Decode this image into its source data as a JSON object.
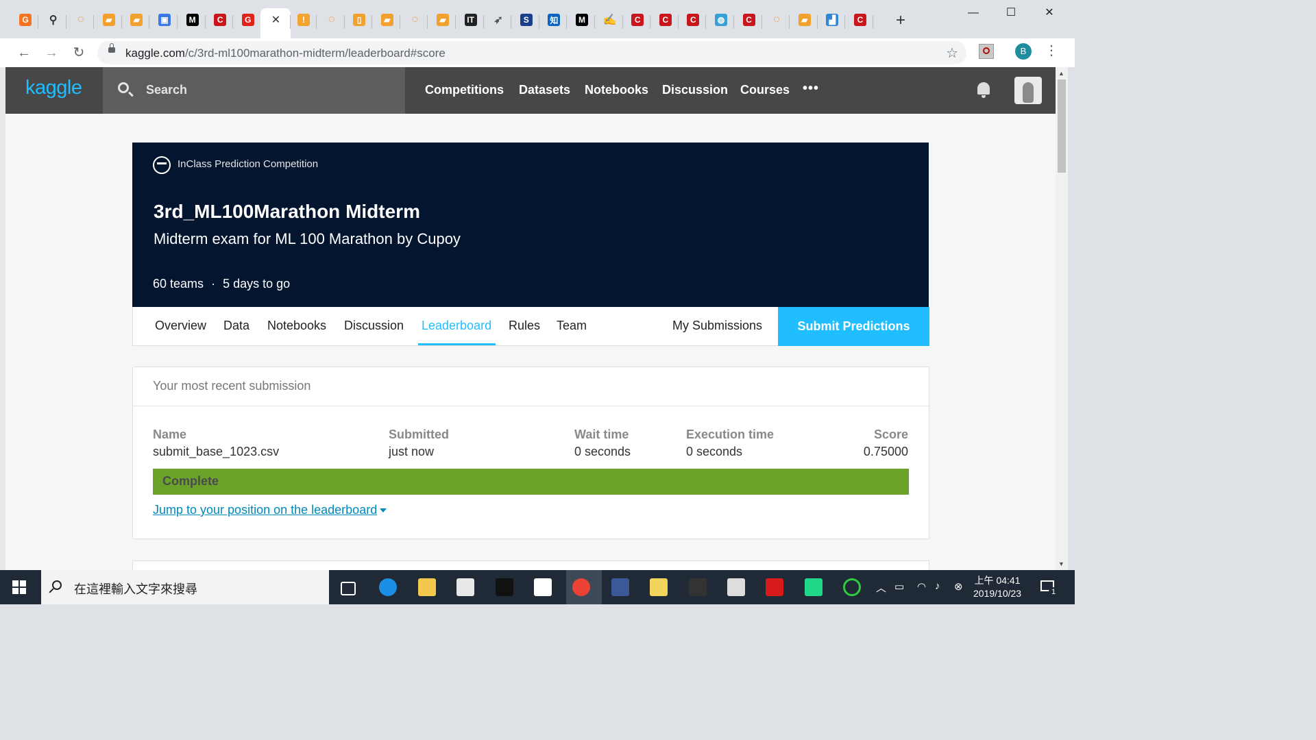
{
  "browser": {
    "tab_icons": [
      {
        "name": "firefox-like-icon",
        "color": "#f97420",
        "glyph": "G"
      },
      {
        "name": "network-icon",
        "color": "#333333",
        "glyph": "⚲"
      },
      {
        "name": "loading-icon",
        "color": "#f57c00",
        "glyph": "◌"
      },
      {
        "name": "book-icon",
        "color": "#f2a12f",
        "glyph": "▰"
      },
      {
        "name": "book-icon",
        "color": "#f2a12f",
        "glyph": "▰"
      },
      {
        "name": "contact-icon",
        "color": "#3b78e7",
        "glyph": "▣"
      },
      {
        "name": "medium-icon",
        "color": "#000000",
        "glyph": "M"
      },
      {
        "name": "csdn-icon",
        "color": "#c9161c",
        "glyph": "C"
      },
      {
        "name": "refresh-red-icon",
        "color": "#e2231a",
        "glyph": "G"
      },
      {
        "name": "close-tab-icon",
        "color": "#ffffff",
        "glyph": "✕"
      },
      {
        "name": "kaggle-tab-icon",
        "color": "#f1a431",
        "glyph": "!"
      },
      {
        "name": "loading-icon",
        "color": "#f57c00",
        "glyph": "◌"
      },
      {
        "name": "document-icon",
        "color": "#f2a12f",
        "glyph": "▯"
      },
      {
        "name": "book-icon",
        "color": "#f2a12f",
        "glyph": "▰"
      },
      {
        "name": "loading-icon",
        "color": "#f57c00",
        "glyph": "◌"
      },
      {
        "name": "book-icon",
        "color": "#f2a12f",
        "glyph": "▰"
      },
      {
        "name": "ithome-icon",
        "color": "#222222",
        "glyph": "IT"
      },
      {
        "name": "bird-icon",
        "color": "#555555",
        "glyph": "➶"
      },
      {
        "name": "s-circle-icon",
        "color": "#1a3f8a",
        "glyph": "S"
      },
      {
        "name": "zhihu-icon",
        "color": "#0a66c2",
        "glyph": "知"
      },
      {
        "name": "medium-icon",
        "color": "#000000",
        "glyph": "M"
      },
      {
        "name": "pen-icon",
        "color": "#444444",
        "glyph": "✍"
      },
      {
        "name": "csdn-icon",
        "color": "#c9161c",
        "glyph": "C"
      },
      {
        "name": "csdn-icon",
        "color": "#c9161c",
        "glyph": "C"
      },
      {
        "name": "csdn-icon",
        "color": "#c9161c",
        "glyph": "C"
      },
      {
        "name": "globe-icon",
        "color": "#3aa0d8",
        "glyph": "◍"
      },
      {
        "name": "csdn-icon",
        "color": "#c9161c",
        "glyph": "C"
      },
      {
        "name": "loading-icon",
        "color": "#f57c00",
        "glyph": "◌"
      },
      {
        "name": "book-icon",
        "color": "#f2a12f",
        "glyph": "▰"
      },
      {
        "name": "chart-icon",
        "color": "#2f87d6",
        "glyph": "▟"
      },
      {
        "name": "csdn-icon",
        "color": "#c9161c",
        "glyph": "C"
      }
    ],
    "new_tab": "+",
    "window_controls": {
      "minimize": "—",
      "maximize": "☐",
      "close": "✕"
    },
    "url_host": "kaggle.com",
    "url_path": "/c/3rd-ml100marathon-midterm/leaderboard#score",
    "profile_initial": "B",
    "nav": {
      "back": "←",
      "forward": "→",
      "reload": "↻",
      "star": "☆",
      "menu": "⋮"
    }
  },
  "kaggle": {
    "logo": "kaggle",
    "search_placeholder": "Search",
    "nav": [
      "Competitions",
      "Datasets",
      "Notebooks",
      "Discussion",
      "Courses"
    ],
    "more": "•••"
  },
  "competition": {
    "kind": "InClass Prediction Competition",
    "title": "3rd_ML100Marathon Midterm",
    "subtitle": "Midterm exam for ML 100 Marathon by Cupoy",
    "teams": "60 teams",
    "separator": "·",
    "deadline": "5 days to go",
    "tabs": [
      "Overview",
      "Data",
      "Notebooks",
      "Discussion",
      "Leaderboard",
      "Rules",
      "Team"
    ],
    "active_tab": "Leaderboard",
    "my_submissions": "My Submissions",
    "submit": "Submit Predictions",
    "accent": "#20beff"
  },
  "submission": {
    "heading": "Your most recent submission",
    "columns": {
      "name": "Name",
      "submitted": "Submitted",
      "wait": "Wait time",
      "exec": "Execution time",
      "score": "Score"
    },
    "values": {
      "name": "submit_base_1023.csv",
      "submitted": "just now",
      "wait": "0 seconds",
      "exec": "0 seconds",
      "score": "0.75000"
    },
    "status": "Complete",
    "status_color": "#6ba32a",
    "jump_link": "Jump to your position on the leaderboard"
  },
  "taskbar": {
    "search_placeholder": "在這裡輸入文字來搜尋",
    "apps": [
      "task-view-icon",
      "edge-icon",
      "file-explorer-icon",
      "store-icon",
      "terminal-icon",
      "mail-icon",
      "chrome-icon",
      "devexpress-icon",
      "python-icon",
      "nox-icon",
      "app-window-icon",
      "acrobat-icon",
      "pycharm-icon",
      "green-ring-icon"
    ],
    "time": "上午 04:41",
    "date": "2019/10/23",
    "notifications": "1"
  }
}
